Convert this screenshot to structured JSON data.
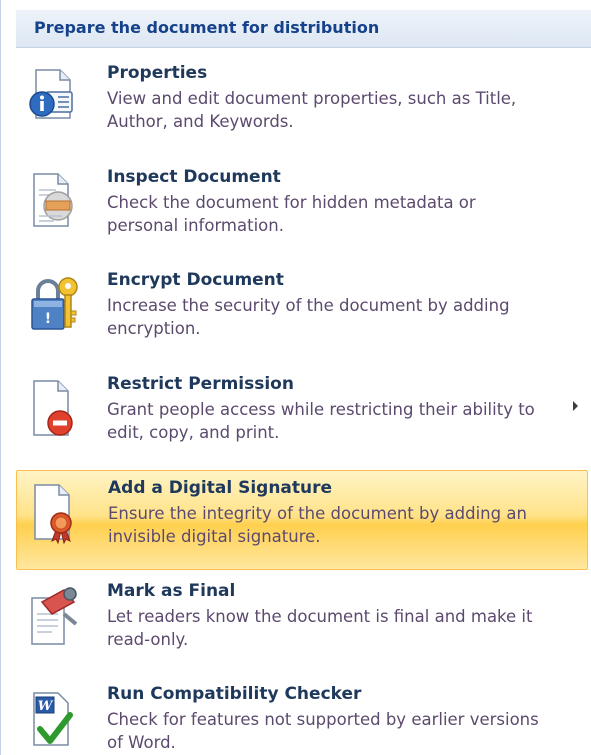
{
  "header": {
    "title": "Prepare the document for distribution"
  },
  "items": [
    {
      "title": "Properties",
      "description": "View and edit document properties, such as Title, Author, and Keywords.",
      "icon": "properties-icon"
    },
    {
      "title": "Inspect Document",
      "description": "Check the document for hidden metadata or personal information.",
      "icon": "inspect-document-icon"
    },
    {
      "title": "Encrypt Document",
      "description": "Increase the security of the document by adding encryption.",
      "icon": "encrypt-lock-key-icon"
    },
    {
      "title": "Restrict Permission",
      "description": "Grant people access while restricting their ability to edit, copy, and print.",
      "icon": "restrict-permission-icon",
      "has_submenu": true
    },
    {
      "title": "Add a Digital Signature",
      "description": "Ensure the integrity of the document by adding an invisible digital signature.",
      "icon": "digital-signature-icon",
      "highlighted": true
    },
    {
      "title": "Mark as Final",
      "description": "Let readers know the document is final and make it read-only.",
      "icon": "mark-as-final-icon"
    },
    {
      "title": "Run Compatibility Checker",
      "description": "Check for features not supported by earlier versions of Word.",
      "icon": "compatibility-checker-icon"
    }
  ],
  "colors": {
    "header_text": "#15428b",
    "title_text": "#1e395b",
    "description_text": "#5c4a6e",
    "highlight": "#ffd04f"
  }
}
